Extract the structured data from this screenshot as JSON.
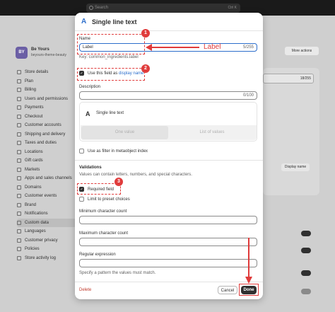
{
  "topbar": {
    "search_placeholder": "Search",
    "shortcut": "Ctrl K"
  },
  "store": {
    "avatar": "BY",
    "name": "Be Yours",
    "subdomain": "beyours-theme-beauty"
  },
  "sidebar": {
    "items": [
      {
        "label": "Store details"
      },
      {
        "label": "Plan"
      },
      {
        "label": "Billing"
      },
      {
        "label": "Users and permissions"
      },
      {
        "label": "Payments"
      },
      {
        "label": "Checkout"
      },
      {
        "label": "Customer accounts"
      },
      {
        "label": "Shipping and delivery"
      },
      {
        "label": "Taxes and duties"
      },
      {
        "label": "Locations"
      },
      {
        "label": "Gift cards"
      },
      {
        "label": "Markets"
      },
      {
        "label": "Apps and sales channels"
      },
      {
        "label": "Domains"
      },
      {
        "label": "Customer events"
      },
      {
        "label": "Brand"
      },
      {
        "label": "Notifications"
      },
      {
        "label": "Custom data"
      },
      {
        "label": "Languages"
      },
      {
        "label": "Customer privacy"
      },
      {
        "label": "Policies"
      },
      {
        "label": "Store activity log"
      }
    ],
    "active_index": 17
  },
  "right": {
    "more_actions": "More actions",
    "count": "18/255",
    "chip": "Display name"
  },
  "modal": {
    "title": "Single line text",
    "name_label": "Name",
    "name_value": "Label",
    "name_count": "5/255",
    "key_text": "Key: common_ingredients.label",
    "display_name_text": "Use this field as ",
    "display_name_link": "display name",
    "description_label": "Description",
    "description_count": "0/100",
    "type_name": "Single line text",
    "seg_one": "One value",
    "seg_list": "List of values",
    "filter_label": "Use as filter in metaobject index",
    "validations_title": "Validations",
    "validations_help": "Values can contain letters, numbers, and special characters.",
    "required_label": "Required field",
    "preset_label": "Limit to preset choices",
    "min_label": "Minimum character count",
    "max_label": "Maximum character count",
    "regex_label": "Regular expression",
    "regex_help": "Specify a pattern the values must match.",
    "delete_label": "Delete",
    "cancel_label": "Cancel",
    "done_label": "Done"
  },
  "annotations": {
    "badge1": "1",
    "badge2": "2",
    "badge3": "3",
    "arrow_text": "Label",
    "color": "#e03b3b"
  }
}
